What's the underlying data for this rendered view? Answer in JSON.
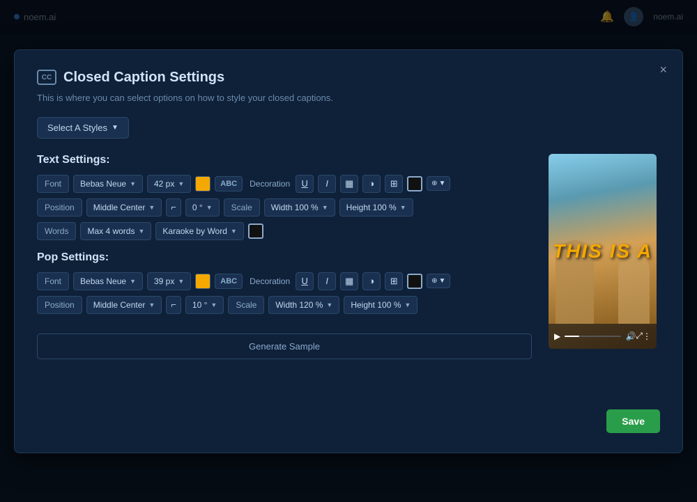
{
  "topbar": {
    "logo_text": "noem.ai",
    "logo_icon": "●"
  },
  "modal": {
    "title": "Closed Caption Settings",
    "subtitle": "This is where you can select options on how to style your closed captions.",
    "select_styles_label": "Select A Styles",
    "close_icon": "×",
    "text_settings_heading": "Text Settings:",
    "pop_settings_heading": "Pop Settings:",
    "generate_sample_label": "Generate Sample",
    "save_label": "Save",
    "text_settings": {
      "font_label": "Font",
      "font_value": "Bebas Neue",
      "font_size": "42 px",
      "decoration_label": "Decoration",
      "position_label": "Position",
      "position_value": "Middle Center",
      "rotation_value": "0 °",
      "scale_label": "Scale",
      "width_value": "Width 100 %",
      "height_value": "Height 100 %",
      "words_label": "Words",
      "max_words": "Max 4 words",
      "karaoke": "Karaoke by Word"
    },
    "pop_settings": {
      "font_label": "Font",
      "font_value": "Bebas Neue",
      "font_size": "39 px",
      "decoration_label": "Decoration",
      "position_label": "Position",
      "position_value": "Middle Center",
      "rotation_value": "10 °",
      "scale_label": "Scale",
      "width_value": "Width 120 %",
      "height_value": "Height 100 %"
    }
  },
  "video_preview": {
    "text": "THIS IS A"
  }
}
